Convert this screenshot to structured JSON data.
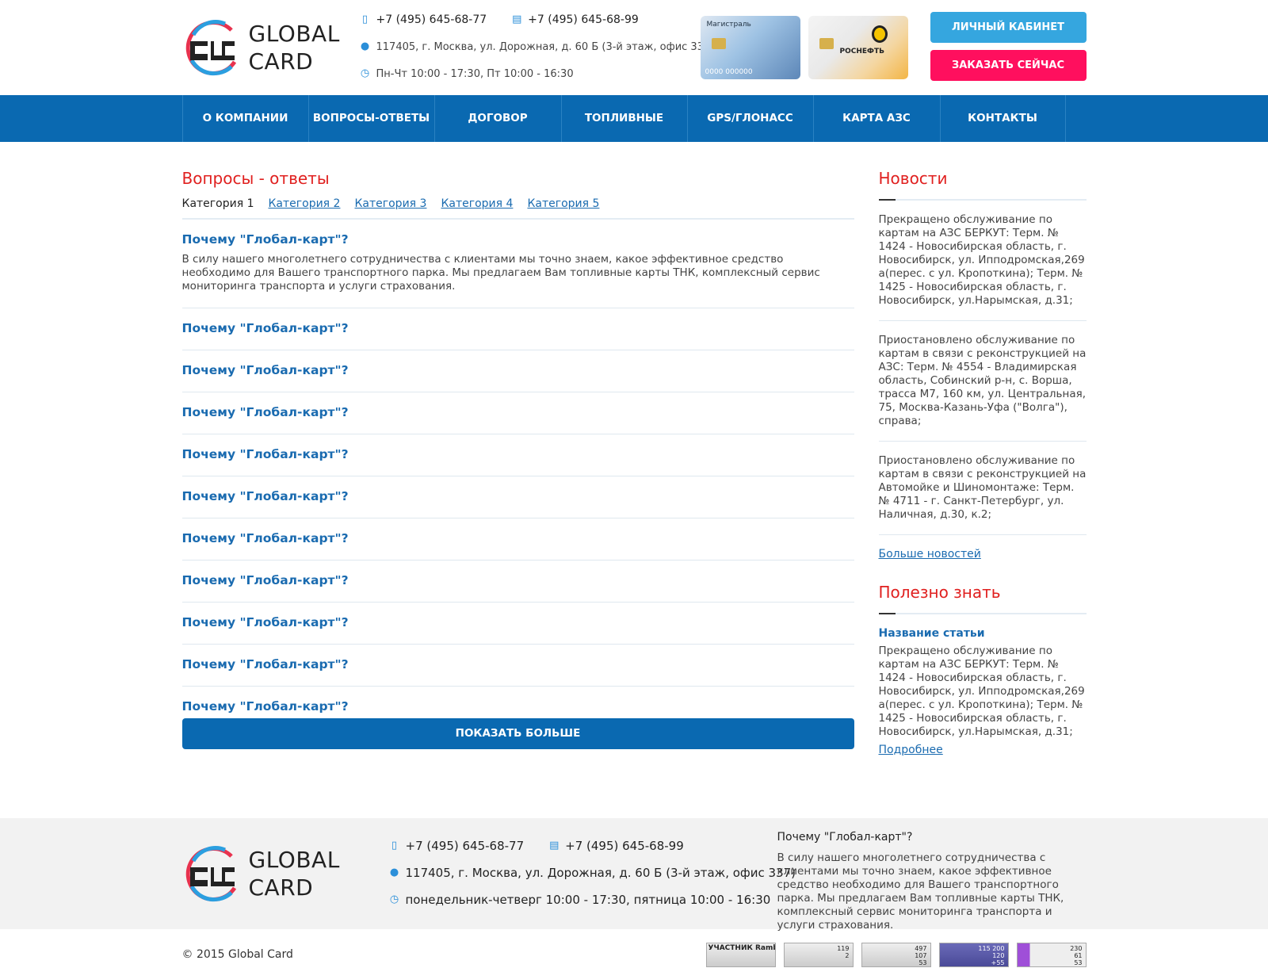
{
  "brand": {
    "line1": "GLOBAL",
    "line2": "CARD"
  },
  "header": {
    "phone1": "+7 (495) 645-68-77",
    "phone2": "+7 (495) 645-68-99",
    "address": "117405, г. Москва, ул. Дорожная, д. 60 Б (3-й этаж, офис 337)",
    "hours": "Пн-Чт 10:00 - 17:30, Пт 10:00 - 16:30",
    "card1_label": "Магистраль",
    "card1_number": "0000 000000",
    "card2_label": "РОСНЕФТЬ",
    "cabinet_btn": "ЛИЧНЫЙ КАБИНЕТ",
    "order_btn": "ЗАКАЗАТЬ СЕЙЧАС"
  },
  "nav": [
    "О КОМПАНИИ",
    "ВОПРОСЫ-ОТВЕТЫ",
    "ДОГОВОР",
    "ТОПЛИВНЫЕ КАРТЫ",
    "GPS/ГЛОНАСС",
    "КАРТА АЗС",
    "КОНТАКТЫ"
  ],
  "faq": {
    "title": "Вопросы - ответы",
    "tabs": [
      "Категория 1",
      "Категория 2",
      "Категория 3",
      "Категория 4",
      "Категория 5"
    ],
    "open_question": "Почему \"Глобал-карт\"?",
    "open_answer": "В силу нашего многолетнего сотрудничества с клиентами мы точно знаем, какое эффективное средство необходимо для Вашего транспортного парка. Мы предлагаем Вам топливные карты ТНК, комплексный сервис мониторинга транспорта и услуги страхования.",
    "questions": [
      "Почему \"Глобал-карт\"?",
      "Почему \"Глобал-карт\"?",
      "Почему \"Глобал-карт\"?",
      "Почему \"Глобал-карт\"?",
      "Почему \"Глобал-карт\"?",
      "Почему \"Глобал-карт\"?",
      "Почему \"Глобал-карт\"?",
      "Почему \"Глобал-карт\"?",
      "Почему \"Глобал-карт\"?",
      "Почему \"Глобал-карт\"?"
    ],
    "more_btn": "ПОКАЗАТЬ БОЛЬШЕ"
  },
  "news": {
    "title": "Новости",
    "items": [
      "Прекращено обслуживание по картам на АЗС БЕРКУТ: Терм. № 1424 - Новосибирская область, г. Новосибирск, ул. Ипподромская,269 а(перес. с ул. Кропоткина); Терм. № 1425 - Новосибирская область, г. Новосибирск, ул.Нарымская, д.31;",
      "Приостановлено обслуживание по картам в связи с реконструкцией на АЗС: Терм. № 4554 - Владимирская область, Собинский р-н, с. Ворша, трасса М7, 160 км, ул. Центральная, 75, Москва-Казань-Уфа (\"Волга\"), справа;",
      "Приостановлено обслуживание по картам в связи с реконструкцией на Автомойке и Шиномонтаже: Терм. № 4711 - г. Санкт-Петербург, ул. Наличная, д.30, к.2;"
    ],
    "more": "Больше новостей"
  },
  "useful": {
    "title": "Полезно знать",
    "article_title": "Название статьи",
    "article_text": "Прекращено обслуживание по картам на АЗС БЕРКУТ: Терм. № 1424 - Новосибирская область, г. Новосибирск, ул. Ипподромская,269 а(перес. с ул. Кропоткина); Терм. № 1425 - Новосибирская область, г. Новосибирск, ул.Нарымская, д.31;",
    "more": "Подробнее"
  },
  "footer": {
    "phone1": "+7 (495) 645-68-77",
    "phone2": "+7 (495) 645-68-99",
    "address": "117405, г. Москва, ул. Дорожная, д. 60 Б (3-й этаж, офис 337)",
    "hours": "понедельник-четверг 10:00 - 17:30, пятница 10:00 - 16:30",
    "about_title": "Почему \"Глобал-карт\"?",
    "about_text": "В силу нашего многолетнего сотрудничества с клиентами мы точно знаем, какое эффективное средство необходимо для Вашего транспортного парка. Мы предлагаем Вам топливные карты ТНК, комплексный сервис мониторинга транспорта и услуги страхования.",
    "copyright": "© 2015 Global Card",
    "counters": [
      "УЧАСТНИК Rambler's TOP100",
      "119\n2",
      "497\n107\n53",
      "115 200\n120\n+55",
      "230\n61\n53"
    ]
  },
  "colors": {
    "accent_red": "#e0201f",
    "nav_blue": "#0a69b1",
    "btn_blue": "#35a6df",
    "btn_red": "#ff0f5e"
  }
}
